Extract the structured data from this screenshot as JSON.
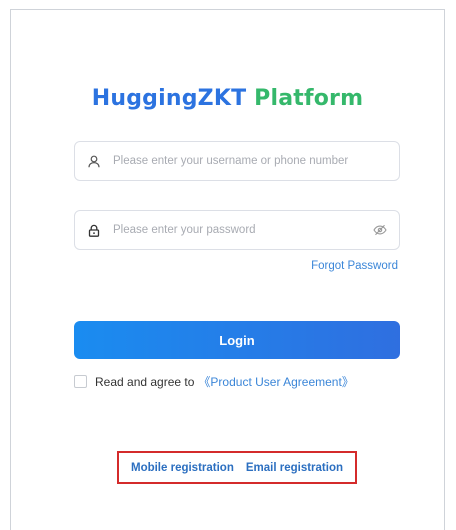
{
  "title": {
    "part1": "HuggingZKT",
    "part2": " Platform"
  },
  "username": {
    "placeholder": "Please enter your username or phone number",
    "icon": "user-icon"
  },
  "password": {
    "placeholder": "Please enter your password",
    "icon": "lock-icon",
    "toggle_icon": "eye-off-icon"
  },
  "forgot_label": "Forgot Password",
  "login_label": "Login",
  "agreement": {
    "prefix": "Read and agree to",
    "link": "《Product User Agreement》",
    "checked": false
  },
  "registration": {
    "mobile": "Mobile registration",
    "email": "Email registration"
  },
  "colors": {
    "primary": "#2c73e0",
    "accent_green": "#35b86b",
    "link": "#3b86d8",
    "highlight_border": "#d42b2b"
  }
}
